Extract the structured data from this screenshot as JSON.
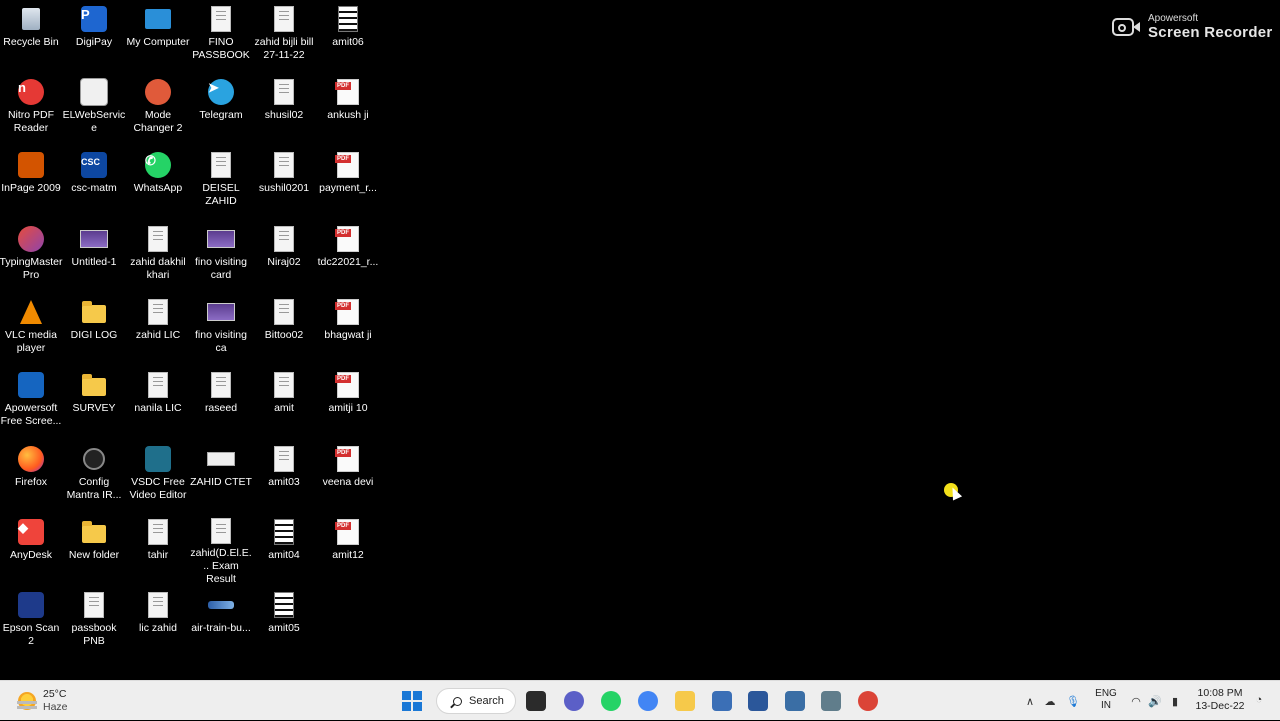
{
  "desktop": {
    "icons": [
      {
        "label": "Recycle Bin",
        "icon": "recycle-bin-icon",
        "col": 0,
        "row": 0
      },
      {
        "label": "DigiPay",
        "icon": "digipay-icon",
        "col": 1,
        "row": 0
      },
      {
        "label": "My Computer",
        "icon": "computer-icon",
        "col": 2,
        "row": 0
      },
      {
        "label": "FINO PASSBOOK",
        "icon": "document-icon",
        "col": 3,
        "row": 0
      },
      {
        "label": "zahid bijli bill 27-11-22",
        "icon": "document-icon",
        "col": 4,
        "row": 0
      },
      {
        "label": "amit06",
        "icon": "striped-document-icon",
        "col": 5,
        "row": 0
      },
      {
        "label": "Nitro PDF Reader",
        "icon": "nitro-pdf-icon",
        "col": 0,
        "row": 1
      },
      {
        "label": "ELWebService",
        "icon": "elwebservice-icon",
        "col": 1,
        "row": 1
      },
      {
        "label": "Mode Changer 2",
        "icon": "mode-changer-icon",
        "col": 2,
        "row": 1
      },
      {
        "label": "Telegram",
        "icon": "telegram-icon",
        "col": 3,
        "row": 1
      },
      {
        "label": "shusil02",
        "icon": "document-icon",
        "col": 4,
        "row": 1
      },
      {
        "label": "ankush ji",
        "icon": "pdf-icon",
        "col": 5,
        "row": 1
      },
      {
        "label": "InPage 2009",
        "icon": "inpage-icon",
        "col": 0,
        "row": 2
      },
      {
        "label": "csc-matm",
        "icon": "csc-icon",
        "col": 1,
        "row": 2
      },
      {
        "label": "WhatsApp",
        "icon": "whatsapp-icon",
        "col": 2,
        "row": 2
      },
      {
        "label": "DEISEL ZAHID",
        "icon": "document-icon",
        "col": 3,
        "row": 2
      },
      {
        "label": "sushil0201",
        "icon": "document-icon",
        "col": 4,
        "row": 2
      },
      {
        "label": "payment_r...",
        "icon": "pdf-icon",
        "col": 5,
        "row": 2
      },
      {
        "label": "TypingMaster Pro",
        "icon": "typingmaster-icon",
        "col": 0,
        "row": 3
      },
      {
        "label": "Untitled-1",
        "icon": "image-file-icon",
        "col": 1,
        "row": 3
      },
      {
        "label": "zahid dakhil khari",
        "icon": "document-icon",
        "col": 2,
        "row": 3
      },
      {
        "label": "fino visiting card",
        "icon": "image-file-icon",
        "col": 3,
        "row": 3
      },
      {
        "label": "Niraj02",
        "icon": "document-icon",
        "col": 4,
        "row": 3
      },
      {
        "label": "tdc22021_r...",
        "icon": "pdf-icon",
        "col": 5,
        "row": 3
      },
      {
        "label": "VLC media player",
        "icon": "vlc-icon",
        "col": 0,
        "row": 4
      },
      {
        "label": "DIGI LOG",
        "icon": "folder-icon",
        "col": 1,
        "row": 4
      },
      {
        "label": "zahid LIC",
        "icon": "document-icon",
        "col": 2,
        "row": 4
      },
      {
        "label": "fino visiting ca",
        "icon": "image-file-icon",
        "col": 3,
        "row": 4
      },
      {
        "label": "Bittoo02",
        "icon": "document-icon",
        "col": 4,
        "row": 4
      },
      {
        "label": "bhagwat ji",
        "icon": "pdf-icon",
        "col": 5,
        "row": 4
      },
      {
        "label": "Apowersoft Free Scree...",
        "icon": "apowersoft-icon",
        "col": 0,
        "row": 5
      },
      {
        "label": "SURVEY",
        "icon": "folder-icon",
        "col": 1,
        "row": 5
      },
      {
        "label": "nanila LIC",
        "icon": "document-icon",
        "col": 2,
        "row": 5
      },
      {
        "label": "raseed",
        "icon": "document-icon",
        "col": 3,
        "row": 5
      },
      {
        "label": "amit",
        "icon": "document-icon",
        "col": 4,
        "row": 5
      },
      {
        "label": "amitji 10",
        "icon": "pdf-icon",
        "col": 5,
        "row": 5
      },
      {
        "label": "Firefox",
        "icon": "firefox-icon",
        "col": 0,
        "row": 6
      },
      {
        "label": "Config Mantra IR...",
        "icon": "config-mantra-icon",
        "col": 1,
        "row": 6
      },
      {
        "label": "VSDC Free Video Editor",
        "icon": "vsdc-icon",
        "col": 2,
        "row": 6
      },
      {
        "label": "ZAHID CTET",
        "icon": "wide-image-icon",
        "col": 3,
        "row": 6
      },
      {
        "label": "amit03",
        "icon": "document-icon",
        "col": 4,
        "row": 6
      },
      {
        "label": "veena devi",
        "icon": "pdf-icon",
        "col": 5,
        "row": 6
      },
      {
        "label": "AnyDesk",
        "icon": "anydesk-icon",
        "col": 0,
        "row": 7
      },
      {
        "label": "New folder",
        "icon": "folder-icon",
        "col": 1,
        "row": 7
      },
      {
        "label": "tahir",
        "icon": "document-icon",
        "col": 2,
        "row": 7
      },
      {
        "label": "zahid(D.El.E... Exam Result",
        "icon": "document-icon",
        "col": 3,
        "row": 7
      },
      {
        "label": "amit04",
        "icon": "striped-document-icon",
        "col": 4,
        "row": 7
      },
      {
        "label": "amit12",
        "icon": "pdf-icon",
        "col": 5,
        "row": 7
      },
      {
        "label": "Epson Scan 2",
        "icon": "epson-scan-icon",
        "col": 0,
        "row": 8
      },
      {
        "label": "passbook PNB",
        "icon": "document-icon",
        "col": 1,
        "row": 8
      },
      {
        "label": "lic zahid",
        "icon": "document-icon",
        "col": 2,
        "row": 8
      },
      {
        "label": "air-train-bu...",
        "icon": "train-image-icon",
        "col": 3,
        "row": 8
      },
      {
        "label": "amit05",
        "icon": "striped-document-icon",
        "col": 4,
        "row": 8
      }
    ]
  },
  "recorder": {
    "brand": "Apowersoft",
    "title": "Screen Recorder"
  },
  "taskbar": {
    "weather": {
      "temp": "25°C",
      "condition": "Haze"
    },
    "search_label": "Search",
    "pinned": [
      {
        "name": "task-view-icon",
        "color": "#2b2b2b"
      },
      {
        "name": "teams-chat-icon",
        "color": "#5b5fc7"
      },
      {
        "name": "whatsapp-taskbar-icon",
        "color": "#25d366"
      },
      {
        "name": "chrome-icon",
        "color": "#4285f4"
      },
      {
        "name": "file-explorer-icon",
        "color": "#f6c94a"
      },
      {
        "name": "media-app-icon",
        "color": "#3b6fb6"
      },
      {
        "name": "word-icon",
        "color": "#2b579a"
      },
      {
        "name": "calculator-icon",
        "color": "#3a6ea5"
      },
      {
        "name": "remote-app-icon",
        "color": "#607d8b"
      },
      {
        "name": "chrome-alt-icon",
        "color": "#db4437"
      }
    ],
    "language": {
      "line1": "ENG",
      "line2": "IN"
    },
    "clock": {
      "time": "10:08 PM",
      "date": "13-Dec-22"
    }
  }
}
